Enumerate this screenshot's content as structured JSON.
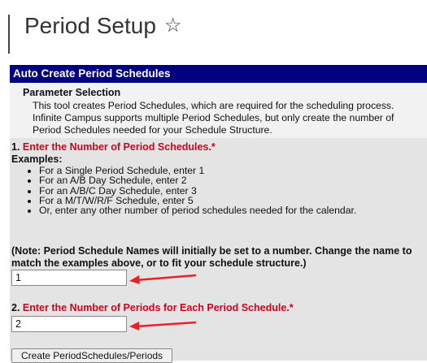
{
  "page": {
    "title": "Period Setup",
    "favorite_icon": "star-outline-icon"
  },
  "panel": {
    "header": "Auto Create Period Schedules",
    "parameter_title": "Parameter Selection",
    "parameter_desc": "This tool creates Period Schedules, which are required for the scheduling process. Infinite Campus supports multiple Period Schedules, but only create the number of Period Schedules needed for your Schedule Structure."
  },
  "step1": {
    "number": "1.",
    "label": "Enter the Number of Period Schedules.*",
    "examples_label": "Examples:",
    "examples": [
      "For a Single Period Schedule, enter 1",
      "For an A/B Day Schedule, enter 2",
      "For an A/B/C Day Schedule, enter 3",
      "For a M/T/W/R/F Schedule, enter 5",
      "Or, enter any other number of period schedules needed for the calendar."
    ],
    "note": "(Note: Period Schedule Names will initially be set to a number. Change the name to match the examples above, or to fit your schedule structure.)",
    "value": "1"
  },
  "step2": {
    "number": "2.",
    "label": "Enter the Number of Periods for Each Period Schedule.*",
    "value": "2"
  },
  "button": {
    "create_label": "Create PeriodSchedules/Periods"
  },
  "colors": {
    "header_bg": "#000080",
    "required_red": "#d0021b",
    "arrow_red": "#e8202a"
  }
}
